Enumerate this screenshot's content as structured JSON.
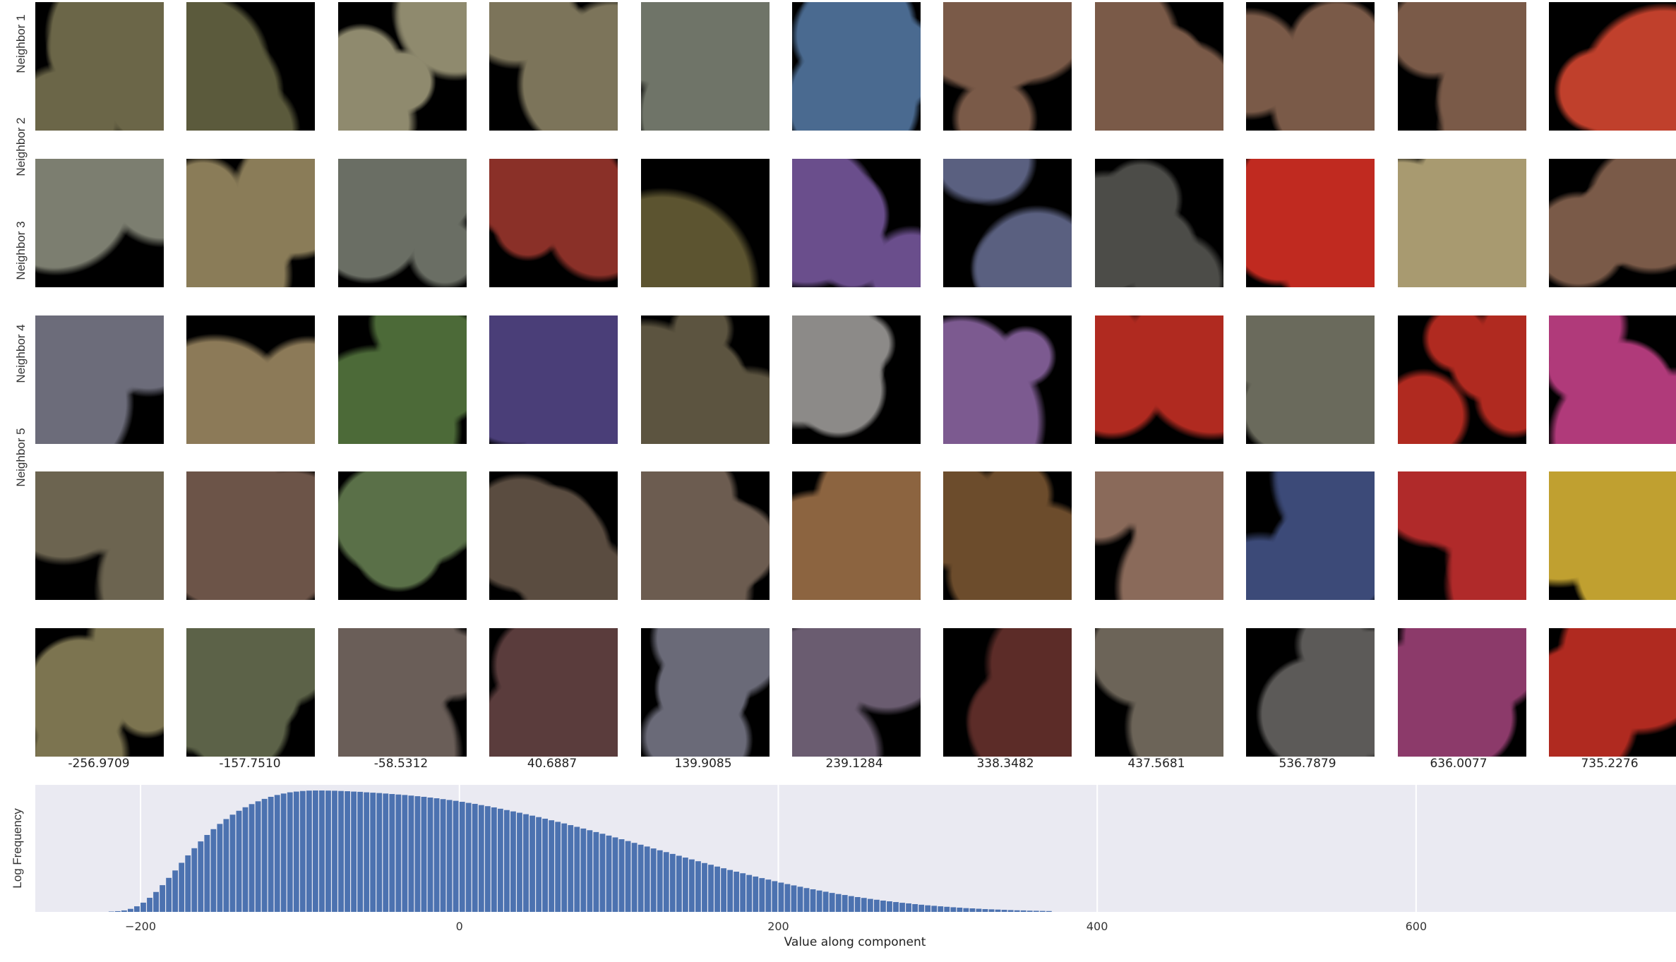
{
  "grid": {
    "row_labels": [
      "Neighbor 1",
      "Neighbor 2",
      "Neighbor 3",
      "Neighbor 4",
      "Neighbor 5"
    ],
    "column_values": [
      "-256.9709",
      "-157.7510",
      "-58.5312",
      "40.6887",
      "139.9085",
      "239.1284",
      "338.3482",
      "437.5681",
      "536.7879",
      "636.0077",
      "735.2276"
    ],
    "palettes": [
      [
        "#6b6648",
        "#5b5a3c",
        "#8f8a6e",
        "#7c745a",
        "#6f7468",
        "#4a6a90",
        "#7a5a48",
        "#7a5a48",
        "#7a5a48",
        "#7a5a48",
        "#c0402c"
      ],
      [
        "#7c7e70",
        "#8a7c58",
        "#6a6e64",
        "#8a3028",
        "#5c5430",
        "#6a4e8c",
        "#5a6080",
        "#4c4c48",
        "#c02a20",
        "#a89a70",
        "#7a5a48"
      ],
      [
        "#6c6c7a",
        "#8c7a58",
        "#4c6a38",
        "#4a3e78",
        "#5c5440",
        "#8c8a88",
        "#7c5a90",
        "#b02a20",
        "#6a6a5c",
        "#b02a20",
        "#b03a7a"
      ],
      [
        "#6c6450",
        "#6c5448",
        "#5a7048",
        "#5a4c40",
        "#6c5c50",
        "#8c6440",
        "#6c4c2c",
        "#8a6a5a",
        "#3c4a78",
        "#b02a2a",
        "#c0a030"
      ],
      [
        "#7c7450",
        "#5c6248",
        "#6a5e58",
        "#5a3c3c",
        "#6a6a78",
        "#6a5c70",
        "#5c2c28",
        "#6c6458",
        "#5c5a58",
        "#8c3a6a",
        "#b02a20"
      ]
    ]
  },
  "chart_data": {
    "type": "bar",
    "xlabel": "Value along component",
    "ylabel": "Log Frequency",
    "xlim": [
      -266,
      763
    ],
    "xticks": [
      -200,
      0,
      200,
      400,
      600
    ],
    "xtick_labels": [
      "−200",
      "0",
      "200",
      "400",
      "600"
    ],
    "grid": true,
    "bar_color": "#4c72b0",
    "bin_start": -220,
    "bin_width": 4,
    "values": [
      0.3,
      0.6,
      1.2,
      2.5,
      4.6,
      7.6,
      11.6,
      16.4,
      22.0,
      28.0,
      34.1,
      40.4,
      46.5,
      52.4,
      58.0,
      63.3,
      68.1,
      72.4,
      76.4,
      80.0,
      83.2,
      86.1,
      88.7,
      91.0,
      93.0,
      94.7,
      96.2,
      97.4,
      98.4,
      99.0,
      99.5,
      99.8,
      99.9,
      99.9,
      99.8,
      99.7,
      99.5,
      99.3,
      99.0,
      98.8,
      98.4,
      98.1,
      97.8,
      97.4,
      97.0,
      96.6,
      96.2,
      95.7,
      95.2,
      94.7,
      94.1,
      93.5,
      92.8,
      92.1,
      91.4,
      90.6,
      89.7,
      88.9,
      87.9,
      87.0,
      86.0,
      84.9,
      83.8,
      82.7,
      81.6,
      80.4,
      79.2,
      78.0,
      76.7,
      75.4,
      74.1,
      72.8,
      71.4,
      70.0,
      68.6,
      67.2,
      65.7,
      64.3,
      62.8,
      61.3,
      59.8,
      58.3,
      56.8,
      55.3,
      53.8,
      52.2,
      50.7,
      49.2,
      47.7,
      46.2,
      44.7,
      43.2,
      41.7,
      40.2,
      38.8,
      37.3,
      35.9,
      34.5,
      33.1,
      31.8,
      30.4,
      29.1,
      27.8,
      26.6,
      25.3,
      24.1,
      22.9,
      21.8,
      20.7,
      19.6,
      18.6,
      17.6,
      16.6,
      15.6,
      14.7,
      13.9,
      13.0,
      12.2,
      11.5,
      10.7,
      10.0,
      9.3,
      8.7,
      8.1,
      7.5,
      7.0,
      6.4,
      5.9,
      5.4,
      5.0,
      4.6,
      4.2,
      3.8,
      3.5,
      3.1,
      2.9,
      2.6,
      2.3,
      2.1,
      1.9,
      1.7,
      1.5,
      1.3,
      1.2,
      1.0,
      0.9,
      0.8,
      0.7
    ]
  }
}
